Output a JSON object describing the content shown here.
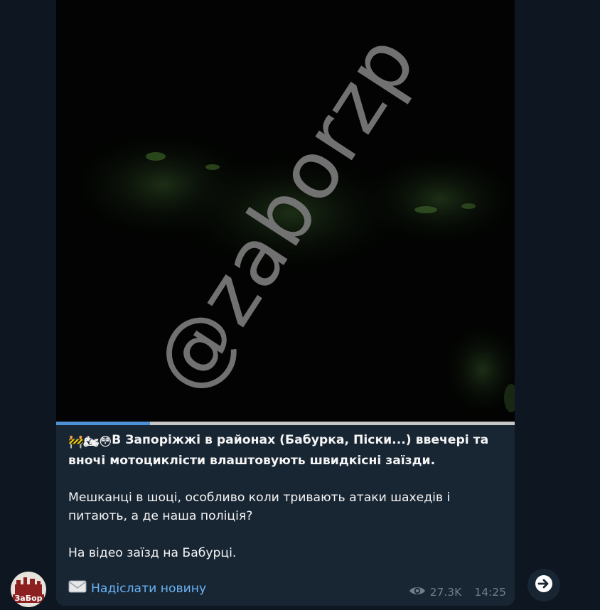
{
  "post": {
    "watermark": "@zaborzp",
    "video_progress": 0.205,
    "caption": {
      "line1_emojis": "🚧🏍😳",
      "headline": "В Запоріжжі в районах (Бабурка, Піски...) ввечері та вночі мотоциклісти влаштовують швидкісні заїзди.",
      "paragraph2": "Мешканці в шоці, особливо коли тривають атаки шахедів і питають, а де наша поліція?",
      "paragraph3": "На відео заїзд на Бабурці."
    },
    "link_label": "Надіслати новину",
    "views": "27.3K",
    "time": "14:25"
  },
  "channel": {
    "avatar_label": "ЗаБор"
  },
  "colors": {
    "background": "#0e1621",
    "bubble": "#182533",
    "link": "#6ab3f3",
    "meta": "#6d7f8f",
    "progress": "#4f8fd6"
  },
  "icons": {
    "views": "eye-icon",
    "share": "forward-arrow-icon",
    "link": "envelope-icon"
  }
}
